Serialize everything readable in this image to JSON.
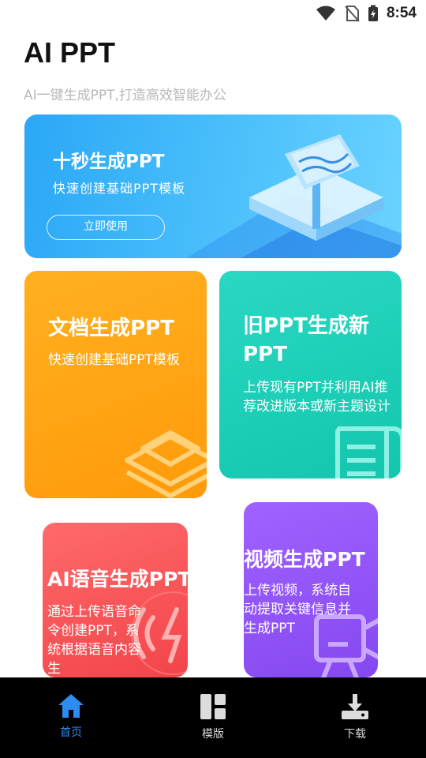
{
  "status": {
    "time": "8:54"
  },
  "app": {
    "title": "AI PPT",
    "subtitle": "AI一键生成PPT,打造高效智能办公"
  },
  "hero": {
    "title": "十秒生成PPT",
    "desc": "快速创建基础PPT模板",
    "cta": "立即使用"
  },
  "cards": {
    "doc": {
      "title": "文档生成PPT",
      "desc": "快速创建基础PPT模板"
    },
    "oldppt": {
      "title": "旧PPT生成新PPT",
      "desc": "上传现有PPT并利用AI推荐改进版本或新主题设计"
    },
    "voice": {
      "title": "AI语音生成PPT",
      "desc": "通过上传语音命令创建PPT，系统根据语音内容生"
    },
    "video": {
      "title": "视频生成PPT",
      "desc": "上传视频，系统自动提取关键信息并生成PPT"
    }
  },
  "nav": {
    "items": [
      {
        "label": "首页",
        "icon": "home-icon",
        "active": true
      },
      {
        "label": "模版",
        "icon": "template-icon",
        "active": false
      },
      {
        "label": "下载",
        "icon": "download-icon",
        "active": false
      }
    ]
  },
  "colors": {
    "accent": "#2c8cf0",
    "hero": "#38b4f8",
    "orange": "#ffa414",
    "teal": "#1fcfb8",
    "red": "#f65456",
    "purple": "#9257f8"
  }
}
